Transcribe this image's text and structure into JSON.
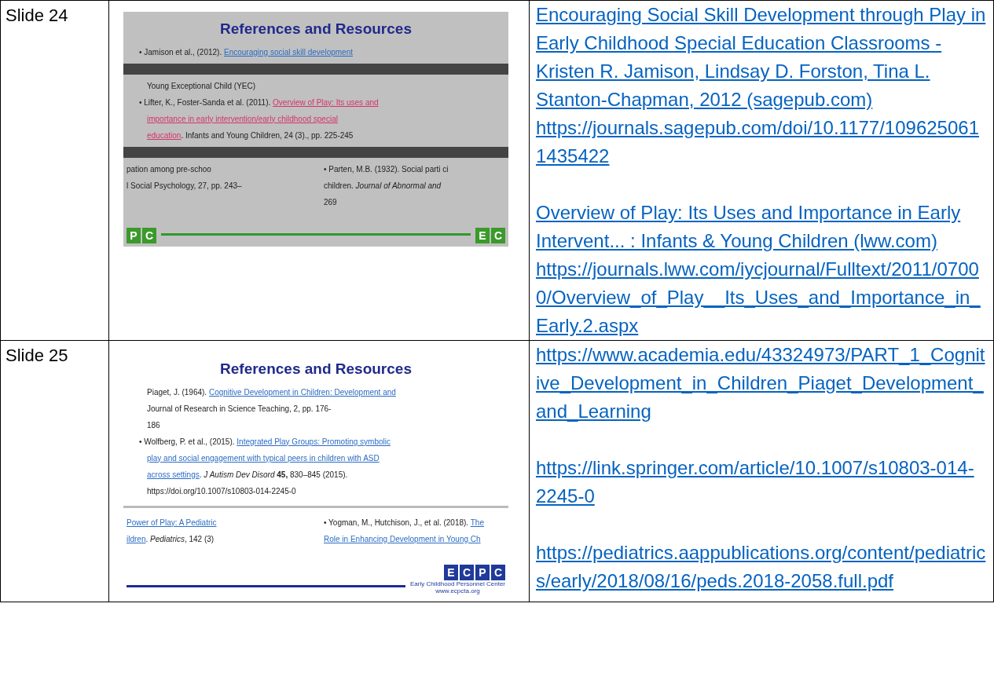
{
  "rows": [
    {
      "label": "Slide 24",
      "slide": {
        "kind": "gray",
        "title": "References and Resources",
        "blocks": [
          {
            "kind": "bullet",
            "lines": [
              [
                {
                  "text": "• Jamison et al., (2012). ",
                  "link": false
                },
                {
                  "text": "Encouraging social skill development",
                  "link": true
                }
              ]
            ]
          },
          {
            "kind": "garbled"
          },
          {
            "kind": "plain",
            "lines": [
              [
                {
                  "text": "Young Exceptional Child (YEC)",
                  "link": false
                }
              ]
            ]
          },
          {
            "kind": "bullet",
            "lines": [
              [
                {
                  "text": "• Lifter, K., Foster-Sanda et al. (2011). ",
                  "link": false
                },
                {
                  "text": "Overview of Play: Its uses and",
                  "link": true
                }
              ],
              [
                {
                  "text": "importance in early intervention/early childhood special",
                  "link": true
                }
              ],
              [
                {
                  "text": "education",
                  "link": true
                },
                {
                  "text": ". Infants and Young Children, 24 (3)., pp. 225-245",
                  "link": false
                }
              ]
            ]
          },
          {
            "kind": "garbled"
          },
          {
            "kind": "split",
            "left": [
              [
                {
                  "text": "pation among pre-schoo",
                  "link": false
                }
              ],
              [
                {
                  "text": "l Social Psychology, 27, pp. 243–",
                  "link": false
                }
              ]
            ],
            "right": [
              [
                {
                  "text": "• Parten, M.B. (1932). Social parti ci",
                  "link": false
                }
              ],
              [
                {
                  "text": "children. *Journal of Abnormal and*",
                  "link": false
                }
              ],
              [
                {
                  "text": "269",
                  "link": false
                }
              ]
            ]
          }
        ],
        "logo_left": [
          "P",
          "C"
        ],
        "logo_right": [
          "E",
          "C"
        ]
      },
      "links": [
        [
          "Encouraging Social Skill Development through Play in Early Childhood Special Education Classrooms - Kristen R. Jamison, Lindsay D. Forston, Tina L. Stanton-Chapman, 2012 (sagepub.com)",
          "https://journals.sagepub.com/doi/10.1177/1096250611435422"
        ],
        [
          "Overview of Play: Its Uses and Importance in Early Intervent... : Infants & Young Children (lww.com)",
          "https://journals.lww.com/iycjournal/Fulltext/2011/07000/Overview_of_Play__Its_Uses_and_Importance_in_Early.2.aspx"
        ]
      ]
    },
    {
      "label": "Slide 25",
      "slide": {
        "kind": "white",
        "title": "References and Resources",
        "blocks": [
          {
            "kind": "plain",
            "lines": [
              [
                {
                  "text": "Piaget, J. (1964). ",
                  "link": false
                },
                {
                  "text": "Cognitive Development in Children: Development and",
                  "link": true
                }
              ],
              [
                {
                  "text": "Journal of Research in Science Teaching, 2, pp. 176-",
                  "link": false
                }
              ],
              [
                {
                  "text": "186",
                  "link": false
                }
              ]
            ]
          },
          {
            "kind": "bullet",
            "lines": [
              [
                {
                  "text": "• Wolfberg, P. et al., (2015). ",
                  "link": false
                },
                {
                  "text": "Integrated Play Groups: Promoting symbolic",
                  "link": true
                }
              ],
              [
                {
                  "text": "play and social engagement with typical peers in children with ASD",
                  "link": true
                }
              ],
              [
                {
                  "text": "across settings",
                  "link": true
                },
                {
                  "text": ". *J Autism Dev Disord* **45,** 830–845 (2015).",
                  "link": false
                }
              ],
              [
                {
                  "text": "https://doi.org/10.1007/s10803-014-2245-0",
                  "link": false
                }
              ]
            ]
          },
          {
            "kind": "garbled"
          },
          {
            "kind": "split",
            "left": [
              [
                {
                  "text": "Power of Play: A Pediatric",
                  "link": true
                }
              ],
              [
                {
                  "text": "ildren",
                  "link": true
                },
                {
                  "text": ". *Pediatrics*, 142 (3)",
                  "link": false
                }
              ]
            ],
            "right": [
              [
                {
                  "text": "• Yogman, M., Hutchison, J., et al. (2018). ",
                  "link": false
                },
                {
                  "text": "The",
                  "link": true
                }
              ],
              [
                {
                  "text": "Role in Enhancing Development in Young Ch",
                  "link": true
                }
              ]
            ]
          }
        ],
        "logo_right": [
          "E",
          "C",
          "P",
          "C"
        ],
        "logo_caption": "Early Childhood Personnel Center",
        "logo_url": "www.ecpcta.org"
      },
      "links": [
        [
          "https://www.academia.edu/43324973/PART_1_Cognitive_Development_in_Children_Piaget_Development_and_Learning"
        ],
        [
          "https://link.springer.com/article/10.1007/s10803-014-2245-0"
        ],
        [
          "https://pediatrics.aappublications.org/content/pediatrics/early/2018/08/16/peds.2018-2058.full.pdf"
        ]
      ]
    }
  ]
}
